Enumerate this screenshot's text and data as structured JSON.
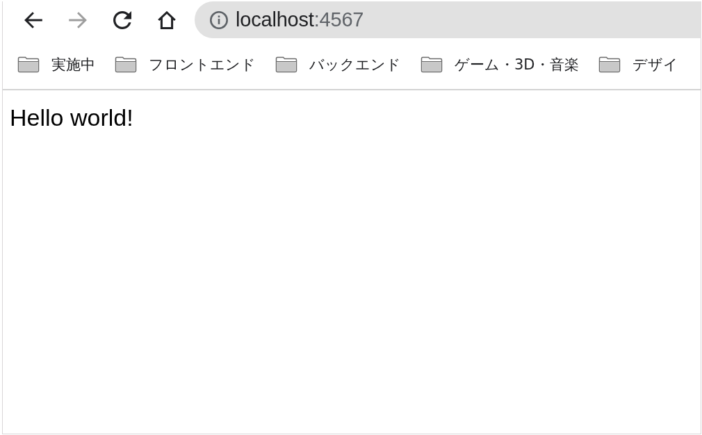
{
  "toolbar": {
    "nav_buttons": [
      {
        "kind": "back",
        "disabled": false
      },
      {
        "kind": "forward",
        "disabled": true
      },
      {
        "kind": "reload",
        "disabled": false
      },
      {
        "kind": "home",
        "disabled": false
      }
    ],
    "address_bar": {
      "host": "localhost",
      "port": ":4567"
    }
  },
  "bookmarks": [
    {
      "label": "実施中"
    },
    {
      "label": "フロントエンド"
    },
    {
      "label": "バックエンド"
    },
    {
      "label": "ゲーム・3D・音楽"
    },
    {
      "label": "デザイ"
    }
  ],
  "page": {
    "text": "Hello world!"
  }
}
